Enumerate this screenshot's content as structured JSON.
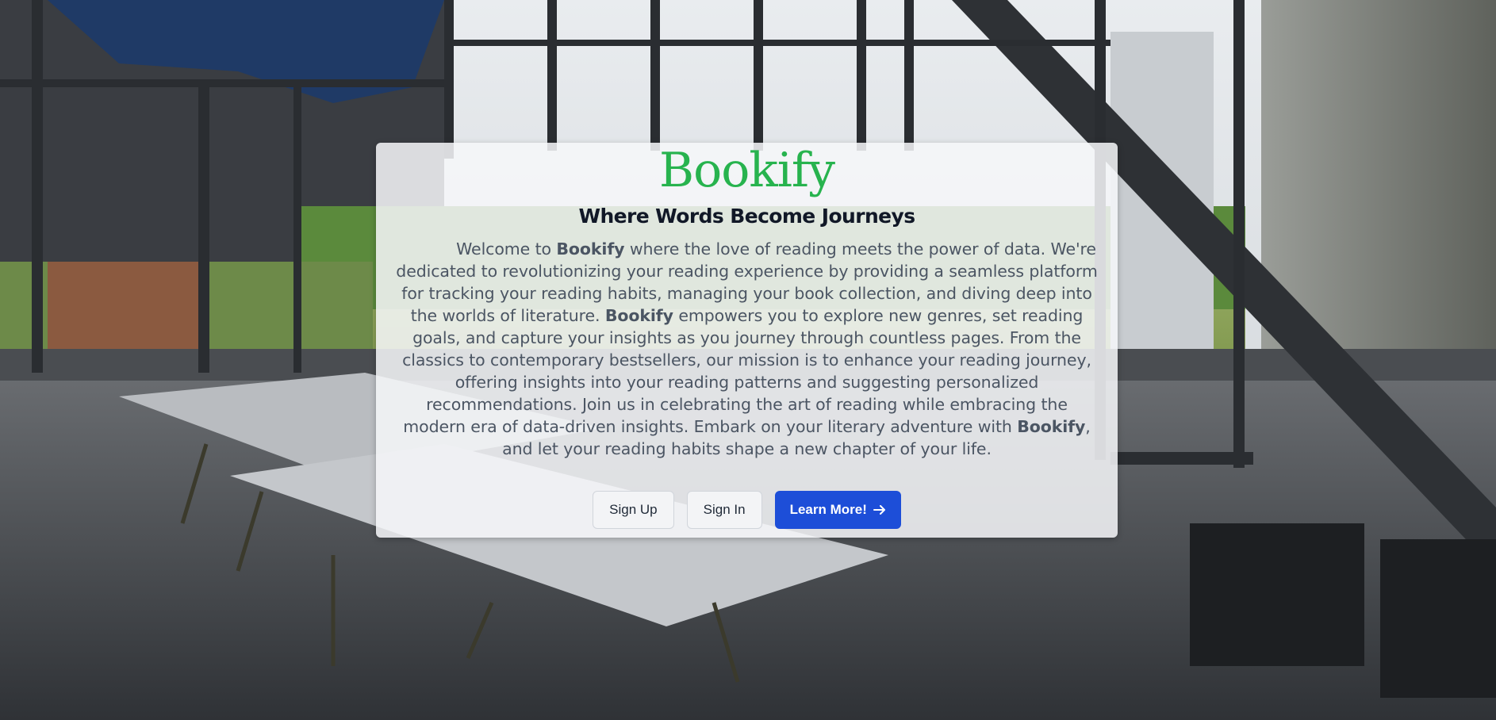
{
  "brand": {
    "logo_text": "Bookify",
    "logo_color": "#27b34e"
  },
  "hero": {
    "tagline": "Where Words Become Journeys",
    "intro": {
      "p1": "Welcome to ",
      "b1": "Bookify",
      "p2": " where the love of reading meets the power of data. We're dedicated to revolutionizing your reading experience by providing a seamless platform for tracking your reading habits, managing your book collection, and diving deep into the worlds of literature. ",
      "b2": "Bookify",
      "p3": " empowers you to explore new genres, set reading goals, and capture your insights as you journey through countless pages. From the classics to contemporary bestsellers, our mission is to enhance your reading journey, offering insights into your reading patterns and suggesting personalized recommendations. Join us in celebrating the art of reading while embracing the modern era of data-driven insights. Embark on your literary adventure with ",
      "b3": "Bookify",
      "p4": ", and let your reading habits shape a new chapter of your life."
    }
  },
  "actions": {
    "sign_up": "Sign Up",
    "sign_in": "Sign In",
    "learn_more": "Learn More!",
    "learn_more_icon": "arrow-right-icon",
    "primary_color": "#1d4ed8"
  }
}
